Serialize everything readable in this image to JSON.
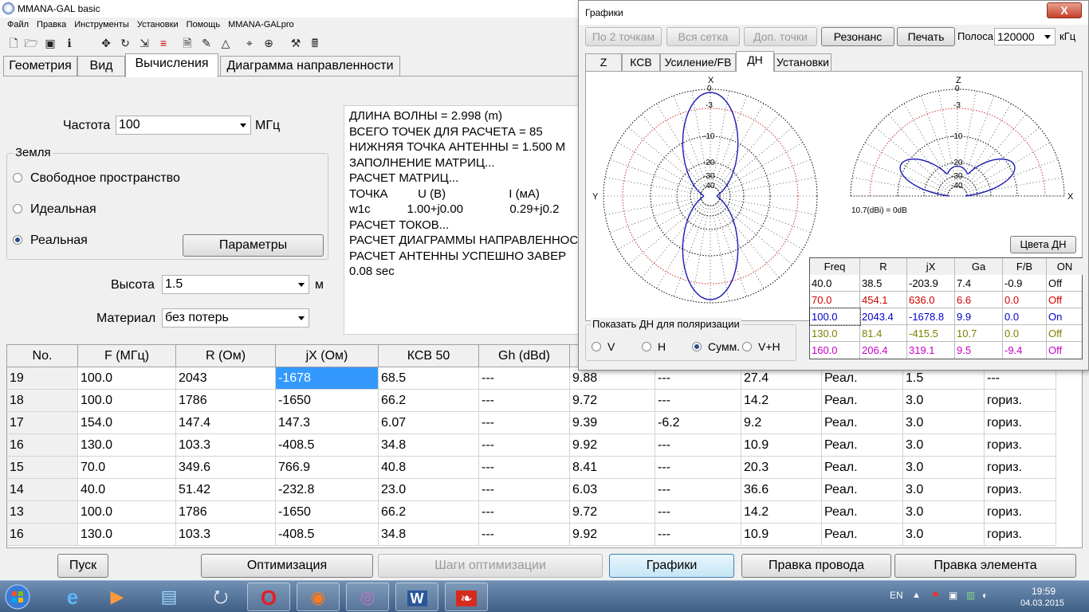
{
  "main": {
    "title": "MMANA-GAL basic",
    "menu": [
      "Файл",
      "Правка",
      "Инструменты",
      "Установки",
      "Помощь",
      "MMANA-GALpro"
    ],
    "toolbar_icons": [
      "new-file-icon",
      "open-folder-icon",
      "save-icon",
      "info-icon",
      "move-icon",
      "rotate-icon",
      "stretch-icon",
      "segment-icon",
      "page-icon",
      "edit-icon",
      "triangle-icon",
      "target-icon",
      "cross-icon",
      "tools-icon",
      "calculator-icon"
    ],
    "tabs": [
      "Геометрия",
      "Вид",
      "Вычисления",
      "Диаграмма направленности"
    ],
    "active_tab": "Вычисления"
  },
  "calc": {
    "freq_label": "Частота",
    "freq_value": "100",
    "freq_unit": "МГц",
    "ground_group": "Земля",
    "ground_options": [
      "Свободное пространство",
      "Идеальная",
      "Реальная"
    ],
    "ground_selected": "Реальная",
    "params_button": "Параметры",
    "height_label": "Высота",
    "height_value": "1.5",
    "height_unit": "м",
    "material_label": "Материал",
    "material_value": "без потерь"
  },
  "log": [
    "ДЛИНА ВОЛНЫ = 2.998 (m)",
    "ВСЕГО ТОЧЕК ДЛЯ РАСЧЕТА = 85",
    "НИЖНЯЯ ТОЧКА АНТЕННЫ = 1.500 M",
    "ЗАПОЛНЕНИЕ МАТРИЦ...",
    "РАСЧЕТ МАТРИЦ...",
    "ТОЧКА         U (B)                   I (мА)",
    "w1c           1.00+j0.00              0.29+j0.2",
    "РАСЧЕТ ТОКОВ...",
    "РАСЧЕТ ДИАГРАММЫ НАПРАВЛЕННОСТИ",
    "РАСЧЕТ АНТЕННЫ УСПЕШНО ЗАВЕР",
    "0.08 sec"
  ],
  "results": {
    "headers": [
      "No.",
      "F (МГц)",
      "R (Ом)",
      "jX (Ом)",
      "КСВ 50",
      "Gh (dBd)"
    ],
    "rows": [
      [
        "19",
        "100.0",
        "2043",
        "-1678",
        "68.5",
        "---",
        "9.88",
        "---",
        "27.4",
        "Реал.",
        "1.5",
        "---"
      ],
      [
        "18",
        "100.0",
        "1786",
        "-1650",
        "66.2",
        "---",
        "9.72",
        "---",
        "14.2",
        "Реал.",
        "3.0",
        "гориз."
      ],
      [
        "17",
        "154.0",
        "147.4",
        "147.3",
        "6.07",
        "---",
        "9.39",
        "-6.2",
        "9.2",
        "Реал.",
        "3.0",
        "гориз."
      ],
      [
        "16",
        "130.0",
        "103.3",
        "-408.5",
        "34.8",
        "---",
        "9.92",
        "---",
        "10.9",
        "Реал.",
        "3.0",
        "гориз."
      ],
      [
        "15",
        "70.0",
        "349.6",
        "766.9",
        "40.8",
        "---",
        "8.41",
        "---",
        "20.3",
        "Реал.",
        "3.0",
        "гориз."
      ],
      [
        "14",
        "40.0",
        "51.42",
        "-232.8",
        "23.0",
        "---",
        "6.03",
        "---",
        "36.6",
        "Реал.",
        "3.0",
        "гориз."
      ],
      [
        "13",
        "100.0",
        "1786",
        "-1650",
        "66.2",
        "---",
        "9.72",
        "---",
        "14.2",
        "Реал.",
        "3.0",
        "гориз."
      ],
      [
        "16",
        "130.0",
        "103.3",
        "-408.5",
        "34.8",
        "---",
        "9.92",
        "---",
        "10.9",
        "Реал.",
        "3.0",
        "гориз."
      ]
    ]
  },
  "bottom_buttons": {
    "start": "Пуск",
    "optimize": "Оптимизация",
    "opt_steps": "Шаги оптимизации",
    "graphs": "Графики",
    "edit_wire": "Правка провода",
    "edit_element": "Правка элемента"
  },
  "graph_window": {
    "title": "Графики",
    "close": "X",
    "buttons": [
      "По 2 точкам",
      "Вся сетка",
      "Доп. точки",
      "Резонанс",
      "Печать"
    ],
    "band_label": "Полоса",
    "band_value": "120000",
    "band_unit": "кГц",
    "tabs": [
      "Z",
      "КСВ",
      "Усиление/FB",
      "ДН",
      "Установки"
    ],
    "active_tab": "ДН",
    "colors_button": "Цвета ДН",
    "pol_group": "Показать ДН для поляризации",
    "pol_options": [
      "V",
      "H",
      "Сумм.",
      "V+H"
    ],
    "pol_selected": "Сумм.",
    "plot_labels": {
      "left_axis_top": "X",
      "left_axis_side": "Y",
      "right_axis_top": "Z",
      "right_axis_side": "X",
      "ring_labels": [
        "0",
        "-3",
        "-10",
        "-20",
        "-30",
        "-40"
      ],
      "gain_ref": "10.7(dBi) = 0dB"
    },
    "freq_table": {
      "headers": [
        "Freq",
        "R",
        "jX",
        "Ga",
        "F/B",
        "ON"
      ],
      "rows": [
        {
          "cells": [
            "40.0",
            "38.5",
            "-203.9",
            "7.4",
            "-0.9",
            "Off"
          ],
          "color": "#000000"
        },
        {
          "cells": [
            "70.0",
            "454.1",
            "636.0",
            "6.6",
            "0.0",
            "Off"
          ],
          "color": "#d00000"
        },
        {
          "cells": [
            "100.0",
            "2043.4",
            "-1678.8",
            "9.9",
            "0.0",
            "On"
          ],
          "color": "#0000c8"
        },
        {
          "cells": [
            "130.0",
            "81.4",
            "-415.5",
            "10.7",
            "0.0",
            "Off"
          ],
          "color": "#808000"
        },
        {
          "cells": [
            "160.0",
            "206.4",
            "319.1",
            "9.5",
            "-9.4",
            "Off"
          ],
          "color": "#c800c8"
        }
      ]
    }
  },
  "taskbar": {
    "apps": [
      "windows-start-icon",
      "ie-icon",
      "media-player-icon",
      "files-icon",
      "teamviewer-icon",
      "opera-icon",
      "firefox-icon",
      "mmana-icon",
      "word-icon",
      "pdf-icon"
    ],
    "lang": "EN",
    "time": "19:59",
    "date": "04.03.2015"
  },
  "colors": {
    "selection": "#3399ff",
    "pattern": "#1a1ab4",
    "grid_red": "#d03030"
  }
}
